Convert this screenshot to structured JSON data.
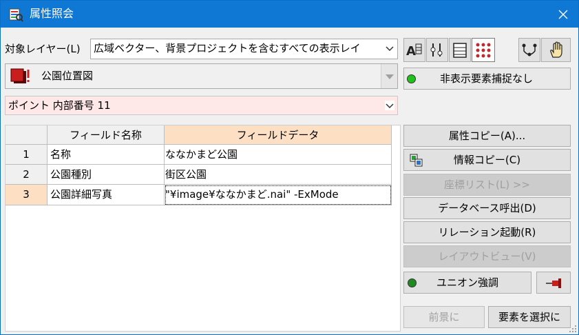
{
  "window": {
    "title": "属性照会",
    "close_glyph": "✕"
  },
  "target_layer": {
    "label": "対象レイヤー(L)",
    "value": "広域ベクター、背景プロジェクトを含むすべての表示レイ"
  },
  "layer_select": {
    "value": "公園位置図"
  },
  "toolbar": {
    "icons": [
      "attribute-search-icon",
      "attribute-filter-icon",
      "table-icon",
      "point-grid-icon",
      "point-snap-icon",
      "hand-icon"
    ],
    "active_index": 3
  },
  "hidden_capture": {
    "label": "非表示要素捕捉なし",
    "led_color": "#21c21b"
  },
  "element_select": {
    "value": "ポイント 内部番号 11"
  },
  "table": {
    "headers": [
      "フィールド名称",
      "フィールドデータ"
    ],
    "rows": [
      {
        "num": "1",
        "name": "名称",
        "data": "ななかまど公園"
      },
      {
        "num": "2",
        "name": "公園種別",
        "data": "街区公園"
      },
      {
        "num": "3",
        "name": "公園詳細写真",
        "data": "\"¥image¥ななかまど.nai\" -ExMode"
      }
    ],
    "selected_row": 2,
    "highlight_color": "#fde0c4"
  },
  "buttons": {
    "copy_attr": "属性コピー(A)...",
    "copy_info": "情報コピー(C)",
    "coord_list": "座標リスト(L) >>",
    "db_call": "データベース呼出(D)",
    "relation": "リレーション起動(R)",
    "layout_view": "レイアウトビュー(V)",
    "union_highlight": "ユニオン強調",
    "union_led_color": "#1f8a1f",
    "pin_icon": "pushpin-icon",
    "foreground": "前景に",
    "select_element": "要素を選択に"
  }
}
